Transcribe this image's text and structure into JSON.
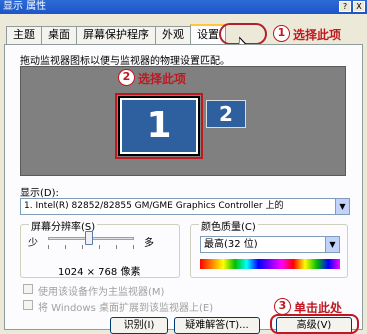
{
  "window": {
    "title": "显示 属性",
    "help_btn": "?",
    "close_btn": "X"
  },
  "tabs": [
    {
      "label": "主题"
    },
    {
      "label": "桌面"
    },
    {
      "label": "屏幕保护程序"
    },
    {
      "label": "外观"
    },
    {
      "label": "设置",
      "active": true
    }
  ],
  "callouts": {
    "c1_num": "1",
    "c1_text": "选择此项",
    "c2_num": "2",
    "c2_text": "选择此项",
    "c3_num": "3",
    "c3_text": "单击此处"
  },
  "settings": {
    "hint": "拖动监视器图标以便与监视器的物理设置匹配。",
    "monitor1": "1",
    "monitor2": "2",
    "display_label": "显示(D):",
    "display_value": "1. Intel(R) 82852/82855 GM/GME Graphics Controller 上的",
    "resolution_title": "屏幕分辨率(S)",
    "res_less": "少",
    "res_more": "多",
    "res_value": "1024 × 768 像素",
    "color_title": "颜色质量(C)",
    "color_value": "最高(32 位)",
    "chk_primary": "使用该设备作为主监视器(M)",
    "chk_extend": "将 Windows 桌面扩展到该监视器上(E)"
  },
  "buttons": {
    "identify": "识别(I)",
    "troubleshoot": "疑难解答(T)...",
    "advanced": "高级(V)"
  },
  "colors": {
    "accent_red": "#c01820",
    "monitor_blue": "#2e5f9e"
  }
}
